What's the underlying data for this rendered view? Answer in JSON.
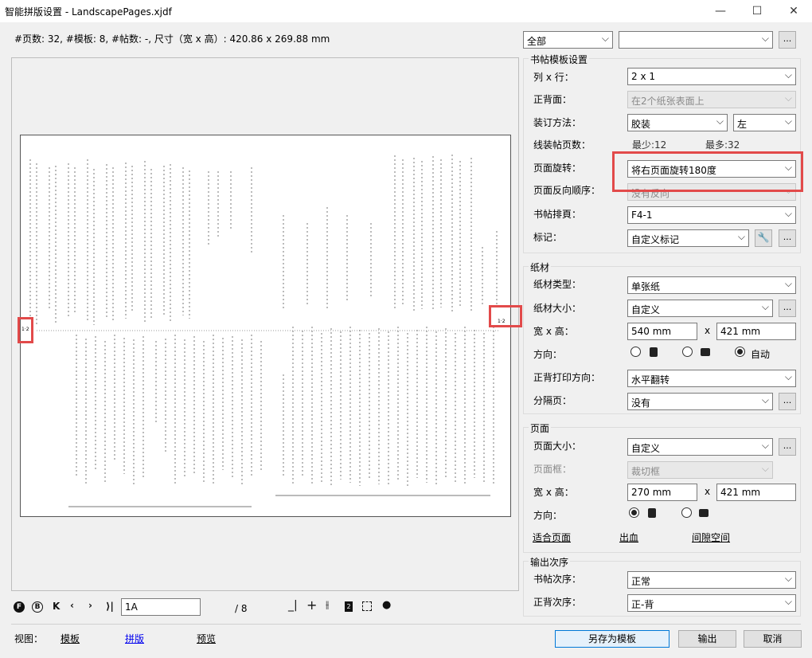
{
  "window": {
    "title": "智能拼版设置 - LandscapePages.xjdf",
    "minimize": "—",
    "maximize": "☐",
    "close": "✕"
  },
  "info": "#页数: 32, #模板: 8, #帖数: -, 尺寸（宽 x 高）: 420.86 x 269.88 mm",
  "top_filters": {
    "scope": "全部",
    "second": ""
  },
  "sheet_text": {
    "left_marker": "1·2",
    "right_marker": "1·2"
  },
  "signature": {
    "group": "书帖模板设置",
    "rows_cols_label": "列 x 行：",
    "rows_cols": "2 x 1",
    "front_back_label": "正背面：",
    "front_back": "在2个纸张表面上",
    "binding_label": "装订方法：",
    "binding": "胶装",
    "binding_side": "左",
    "stitch_label": "线装帖页数：",
    "min": "最少:12",
    "max": "最多:32",
    "page_rotation_label": "页面旋转：",
    "page_rotation": "将右页面旋转180度",
    "reverse_label": "页面反向顺序：",
    "reverse": "没有反向",
    "imposition_label": "书帖排頁：",
    "imposition": "F4-1",
    "marks_label": "标记：",
    "marks": "自定义标记"
  },
  "paper": {
    "group": "纸材",
    "type_label": "纸材类型：",
    "type": "单张纸",
    "size_label": "纸材大小：",
    "size": "自定义",
    "wh_label": "宽 x 高：",
    "width": "540 mm",
    "x": "x",
    "height": "421 mm",
    "orient_label": "方向：",
    "orient_auto": "自动",
    "duplex_label": "正背打印方向：",
    "duplex": "水平翻转",
    "separator_label": "分隔页：",
    "separator": "没有"
  },
  "page": {
    "group": "页面",
    "size_label": "页面大小：",
    "size": "自定义",
    "box_label": "页面框：",
    "box": "裁切框",
    "wh_label": "宽 x 高：",
    "width": "270 mm",
    "x": "x",
    "height": "421 mm",
    "orient_label": "方向：",
    "fit_link": "适合页面",
    "bleed_link": "出血",
    "gap_link": "间隙空间"
  },
  "output": {
    "group": "输出次序",
    "sig_label": "书帖次序：",
    "sig": "正常",
    "side_label": "正背次序：",
    "side": "正-背"
  },
  "nav": {
    "page_value": "1A",
    "total": "/ 8"
  },
  "bottom": {
    "view_label": "视图：",
    "template": "模板",
    "imposition": "拼版",
    "preview": "预览",
    "save_template": "另存为模板",
    "output": "输出",
    "cancel": "取消"
  }
}
